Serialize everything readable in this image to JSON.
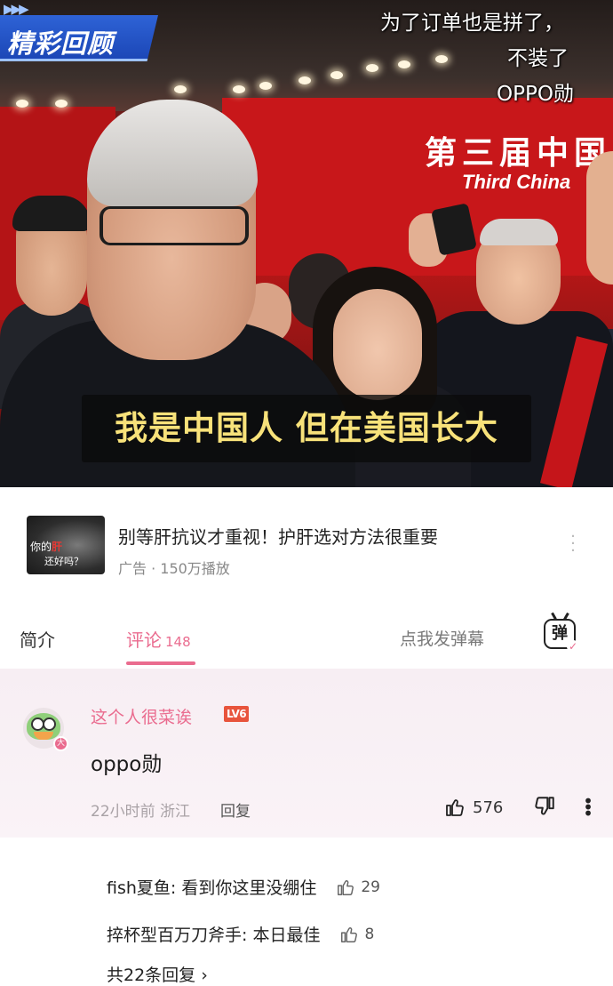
{
  "video": {
    "badge": "精彩回顾",
    "badge_arrows": "▶▶▶",
    "top_right_captions": [
      "为了订单也是拼了，",
      "不装了",
      "OPPO勋"
    ],
    "banner_cn": "第三届中国",
    "banner_en": "Third China",
    "subtitle": "我是中国人 但在美国长大"
  },
  "ad": {
    "thumb_line1_prefix": "你的",
    "thumb_line1_highlight": "肝",
    "thumb_line2": "还好吗？",
    "title": "别等肝抗议才重视！护肝选对方法很重要",
    "meta": "广告 · 150万播放"
  },
  "tabs": {
    "intro": "简介",
    "comments": "评论",
    "comments_count": "148",
    "danmaku_placeholder": "点我发弹幕",
    "danmaku_button": "弹"
  },
  "comment": {
    "username": "这个人很菜诶",
    "level": "LV6",
    "avatar_badge": "大",
    "text": "oppo勋",
    "time_location": "22小时前 浙江",
    "reply_label": "回复",
    "likes": "576"
  },
  "replies": [
    {
      "text": "fish夏鱼: 看到你这里没绷住",
      "likes": "29"
    },
    {
      "text": "捽杯型百万刀斧手: 本日最佳",
      "likes": "8"
    }
  ],
  "more_replies": "共22条回复",
  "colors": {
    "accent_pink": "#ea6c8f",
    "subtitle_yellow": "#f8e27a",
    "badge_blue": "#2e63d6"
  }
}
